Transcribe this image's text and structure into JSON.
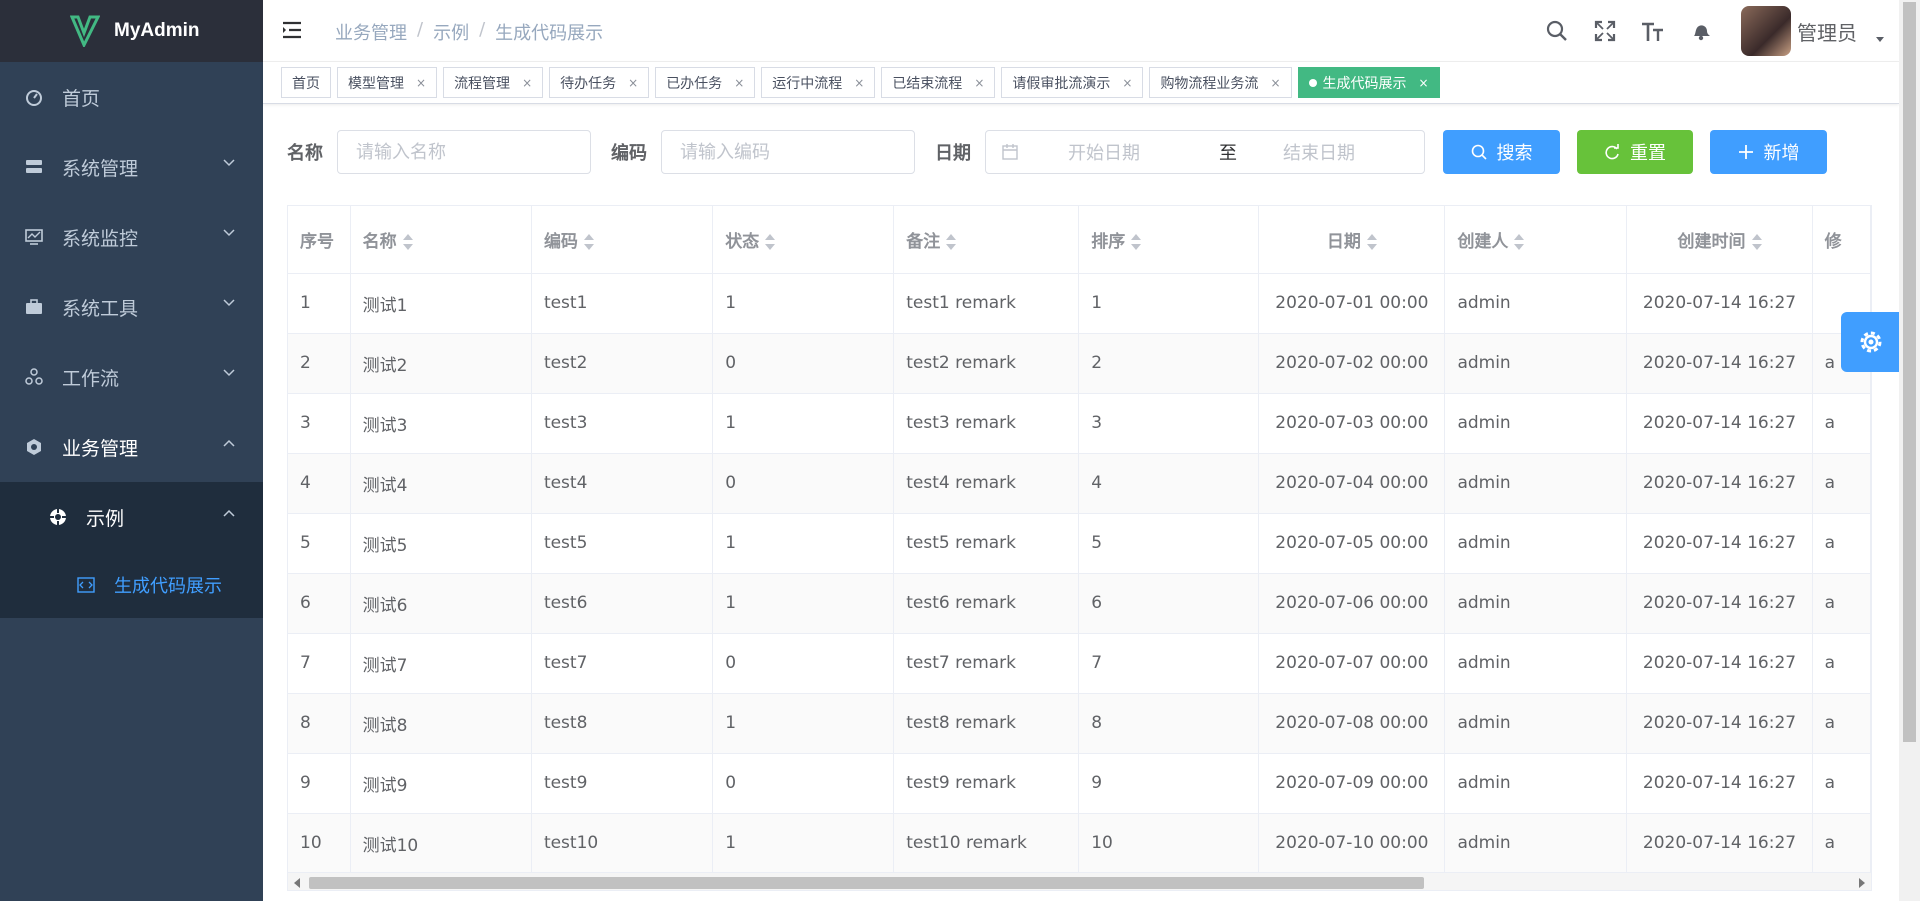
{
  "app": {
    "title": "MyAdmin"
  },
  "sidebar": {
    "items": [
      {
        "label": "首页",
        "icon": "dashboard-icon"
      },
      {
        "label": "系统管理",
        "icon": "system-icon"
      },
      {
        "label": "系统监控",
        "icon": "monitor-icon"
      },
      {
        "label": "系统工具",
        "icon": "tool-icon"
      },
      {
        "label": "工作流",
        "icon": "workflow-icon"
      },
      {
        "label": "业务管理",
        "icon": "business-icon"
      }
    ],
    "sub_item": {
      "label": "示例",
      "icon": "example-icon"
    },
    "leaf_item": {
      "label": "生成代码展示",
      "icon": "code-icon"
    },
    "active_color": "#409eff",
    "bg_color": "#304156"
  },
  "navbar": {
    "breadcrumb": [
      "业务管理",
      "示例",
      "生成代码展示"
    ],
    "breadcrumb_sep": "/",
    "user_name": "管理员"
  },
  "tags": [
    {
      "label": "首页",
      "closable": false
    },
    {
      "label": "模型管理",
      "closable": true
    },
    {
      "label": "流程管理",
      "closable": true
    },
    {
      "label": "待办任务",
      "closable": true
    },
    {
      "label": "已办任务",
      "closable": true
    },
    {
      "label": "运行中流程",
      "closable": true
    },
    {
      "label": "已结束流程",
      "closable": true
    },
    {
      "label": "请假审批流演示",
      "closable": true
    },
    {
      "label": "购物流程业务流",
      "closable": true
    },
    {
      "label": "生成代码展示",
      "closable": true,
      "active": true
    }
  ],
  "tag_close": "×",
  "search": {
    "name_label": "名称",
    "name_placeholder": "请输入名称",
    "code_label": "编码",
    "code_placeholder": "请输入编码",
    "date_label": "日期",
    "start_placeholder": "开始日期",
    "range_sep": "至",
    "end_placeholder": "结束日期",
    "search_btn": "搜索",
    "reset_btn": "重置",
    "add_btn": "新增"
  },
  "table": {
    "columns": [
      {
        "label": "序号",
        "sortable": false,
        "align": "left"
      },
      {
        "label": "名称",
        "sortable": true,
        "align": "left"
      },
      {
        "label": "编码",
        "sortable": true,
        "align": "left"
      },
      {
        "label": "状态",
        "sortable": true,
        "align": "left"
      },
      {
        "label": "备注",
        "sortable": true,
        "align": "left"
      },
      {
        "label": "排序",
        "sortable": true,
        "align": "left"
      },
      {
        "label": "日期",
        "sortable": true,
        "align": "center"
      },
      {
        "label": "创建人",
        "sortable": true,
        "align": "left"
      },
      {
        "label": "创建时间",
        "sortable": true,
        "align": "center"
      },
      {
        "label": "修",
        "sortable": false,
        "align": "left"
      }
    ],
    "rows": [
      [
        "1",
        "测试1",
        "test1",
        "1",
        "test1 remark",
        "1",
        "2020-07-01 00:00",
        "admin",
        "2020-07-14 16:27",
        ""
      ],
      [
        "2",
        "测试2",
        "test2",
        "0",
        "test2 remark",
        "2",
        "2020-07-02 00:00",
        "admin",
        "2020-07-14 16:27",
        "a"
      ],
      [
        "3",
        "测试3",
        "test3",
        "1",
        "test3 remark",
        "3",
        "2020-07-03 00:00",
        "admin",
        "2020-07-14 16:27",
        "a"
      ],
      [
        "4",
        "测试4",
        "test4",
        "0",
        "test4 remark",
        "4",
        "2020-07-04 00:00",
        "admin",
        "2020-07-14 16:27",
        "a"
      ],
      [
        "5",
        "测试5",
        "test5",
        "1",
        "test5 remark",
        "5",
        "2020-07-05 00:00",
        "admin",
        "2020-07-14 16:27",
        "a"
      ],
      [
        "6",
        "测试6",
        "test6",
        "1",
        "test6 remark",
        "6",
        "2020-07-06 00:00",
        "admin",
        "2020-07-14 16:27",
        "a"
      ],
      [
        "7",
        "测试7",
        "test7",
        "0",
        "test7 remark",
        "7",
        "2020-07-07 00:00",
        "admin",
        "2020-07-14 16:27",
        "a"
      ],
      [
        "8",
        "测试8",
        "test8",
        "1",
        "test8 remark",
        "8",
        "2020-07-08 00:00",
        "admin",
        "2020-07-14 16:27",
        "a"
      ],
      [
        "9",
        "测试9",
        "test9",
        "0",
        "test9 remark",
        "9",
        "2020-07-09 00:00",
        "admin",
        "2020-07-14 16:27",
        "a"
      ],
      [
        "10",
        "测试10",
        "test10",
        "1",
        "test10 remark",
        "10",
        "2020-07-10 00:00",
        "admin",
        "2020-07-14 16:27",
        "a"
      ]
    ]
  }
}
